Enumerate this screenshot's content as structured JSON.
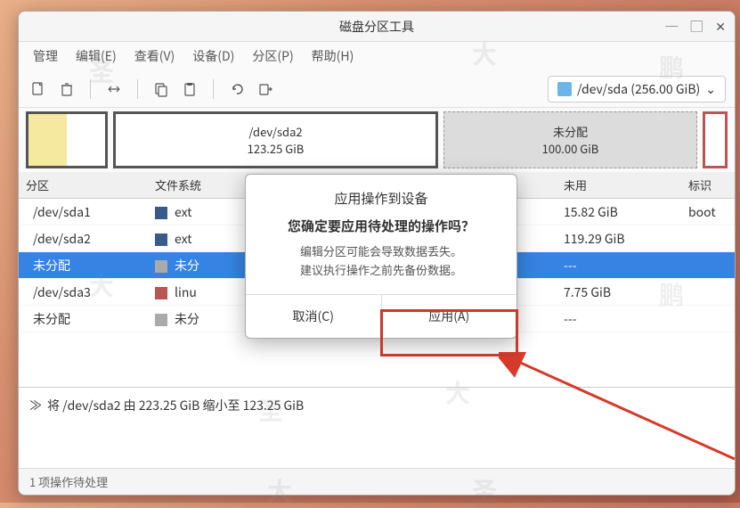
{
  "window": {
    "title": "磁盘分区工具"
  },
  "menu": {
    "manage": "管理",
    "edit": "编辑(E)",
    "view": "查看(V)",
    "device": "设备(D)",
    "partition": "分区(P)",
    "help": "帮助(H)"
  },
  "device_selector": {
    "label": "/dev/sda (256.00 GiB)"
  },
  "diskmap": {
    "sda2_label": "/dev/sda2",
    "sda2_size": "123.25 GiB",
    "unalloc_label": "未分配",
    "unalloc_size": "100.00 GiB"
  },
  "columns": {
    "partition": "分区",
    "filesystem": "文件系统",
    "unused": "未用",
    "flags": "标识"
  },
  "rows": [
    {
      "name": "/dev/sda1",
      "fs": "ext",
      "unused": "15.82 GiB",
      "flags": "boot",
      "swatch": "sw-ext4"
    },
    {
      "name": "/dev/sda2",
      "fs": "ext",
      "unused": "119.29 GiB",
      "flags": "",
      "swatch": "sw-ext4"
    },
    {
      "name": "未分配",
      "fs": "未分",
      "unused": "---",
      "flags": "",
      "swatch": "sw-unalloc",
      "selected": true
    },
    {
      "name": "/dev/sda3",
      "fs": "linu",
      "unused": "7.75 GiB",
      "flags": "",
      "swatch": "sw-swap"
    },
    {
      "name": "未分配",
      "fs": "未分",
      "unused": "---",
      "flags": "",
      "swatch": "sw-unalloc"
    }
  ],
  "operation": {
    "text": "将 /dev/sda2 由 223.25 GiB 缩小至 123.25 GiB"
  },
  "status": {
    "text": "1 项操作待处理"
  },
  "dialog": {
    "title": "应用操作到设备",
    "question": "您确定要应用待处理的操作吗？",
    "line1": "编辑分区可能会导致数据丢失。",
    "line2": "建议执行操作之前先备份数据。",
    "cancel": "取消(C)",
    "apply": "应用(A)"
  }
}
